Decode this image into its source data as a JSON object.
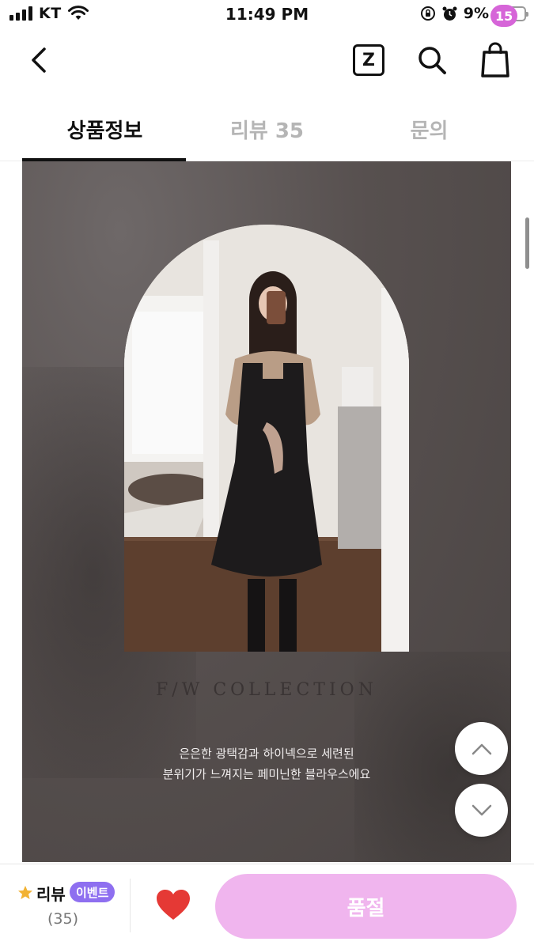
{
  "status_bar": {
    "carrier": "KT",
    "time": "11:49 PM",
    "battery_percent": "9%",
    "battery_level": 0.09,
    "icons": [
      "signal-icon",
      "wifi-icon",
      "orientation-lock-icon",
      "alarm-icon",
      "battery-icon"
    ]
  },
  "nav": {
    "back_icon": "chevron-left-icon",
    "z_label": "Z",
    "search_icon": "search-icon",
    "bag_icon": "shopping-bag-icon",
    "bag_count": "15",
    "badge_color": "#d665d8"
  },
  "tabs": [
    {
      "label": "상품정보",
      "active": true
    },
    {
      "label": "리뷰 35",
      "active": false
    },
    {
      "label": "문의",
      "active": false
    }
  ],
  "product_image": {
    "collection_title": "F/W COLLECTION",
    "description_line1": "은은한 광택감과 하이넥으로 세련된",
    "description_line2": "분위기가 느껴지는 페미닌한 블라우스에요"
  },
  "scroll_buttons": {
    "up_icon": "chevron-up-icon",
    "down_icon": "chevron-down-icon"
  },
  "bottom_bar": {
    "star_icon": "star-icon",
    "review_label": "리뷰",
    "event_badge": "이벤트",
    "event_badge_color": "#8e6ff0",
    "review_count": "(35)",
    "heart_icon": "heart-icon",
    "heart_color": "#e53935",
    "soldout_label": "품절",
    "soldout_color": "#f0b5ee"
  }
}
